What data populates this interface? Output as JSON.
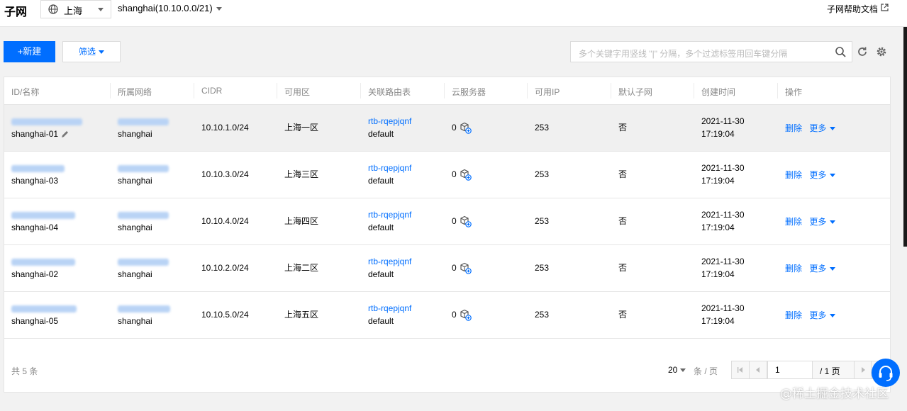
{
  "header": {
    "title": "子网",
    "region": "上海",
    "vpc": "shanghai(10.10.0.0/21)",
    "help_link": "子网帮助文档"
  },
  "toolbar": {
    "new_label": "+新建",
    "filter_label": "筛选",
    "search_placeholder": "多个关键字用竖线 \"|\" 分隔，多个过滤标签用回车键分隔"
  },
  "table": {
    "columns": [
      "ID/名称",
      "所属网络",
      "CIDR",
      "可用区",
      "关联路由表",
      "云服务器",
      "可用IP",
      "默认子网",
      "创建时间",
      "操作"
    ],
    "rows": [
      {
        "name": "shanghai-01",
        "vpc_name": "shanghai",
        "cidr": "10.10.1.0/24",
        "zone": "上海一区",
        "route_id": "rtb-rqepjqnf",
        "route_name": "default",
        "cvm": "0",
        "ip": "253",
        "default": "否",
        "date": "2021-11-30",
        "time": "17:19:04",
        "delete": "删除",
        "more": "更多"
      },
      {
        "name": "shanghai-03",
        "vpc_name": "shanghai",
        "cidr": "10.10.3.0/24",
        "zone": "上海三区",
        "route_id": "rtb-rqepjqnf",
        "route_name": "default",
        "cvm": "0",
        "ip": "253",
        "default": "否",
        "date": "2021-11-30",
        "time": "17:19:04",
        "delete": "删除",
        "more": "更多"
      },
      {
        "name": "shanghai-04",
        "vpc_name": "shanghai",
        "cidr": "10.10.4.0/24",
        "zone": "上海四区",
        "route_id": "rtb-rqepjqnf",
        "route_name": "default",
        "cvm": "0",
        "ip": "253",
        "default": "否",
        "date": "2021-11-30",
        "time": "17:19:04",
        "delete": "删除",
        "more": "更多"
      },
      {
        "name": "shanghai-02",
        "vpc_name": "shanghai",
        "cidr": "10.10.2.0/24",
        "zone": "上海二区",
        "route_id": "rtb-rqepjqnf",
        "route_name": "default",
        "cvm": "0",
        "ip": "253",
        "default": "否",
        "date": "2021-11-30",
        "time": "17:19:04",
        "delete": "删除",
        "more": "更多"
      },
      {
        "name": "shanghai-05",
        "vpc_name": "shanghai",
        "cidr": "10.10.5.0/24",
        "zone": "上海五区",
        "route_id": "rtb-rqepjqnf",
        "route_name": "default",
        "cvm": "0",
        "ip": "253",
        "default": "否",
        "date": "2021-11-30",
        "time": "17:19:04",
        "delete": "删除",
        "more": "更多"
      }
    ]
  },
  "footer": {
    "total": "共 5 条",
    "page_size": "20",
    "per_page": "条 / 页",
    "current_page": "1",
    "total_pages": "/ 1 页"
  },
  "watermark": "@稀土掘金技术社区",
  "colors": {
    "accent": "#006eff",
    "border": "#e5e5e5"
  }
}
